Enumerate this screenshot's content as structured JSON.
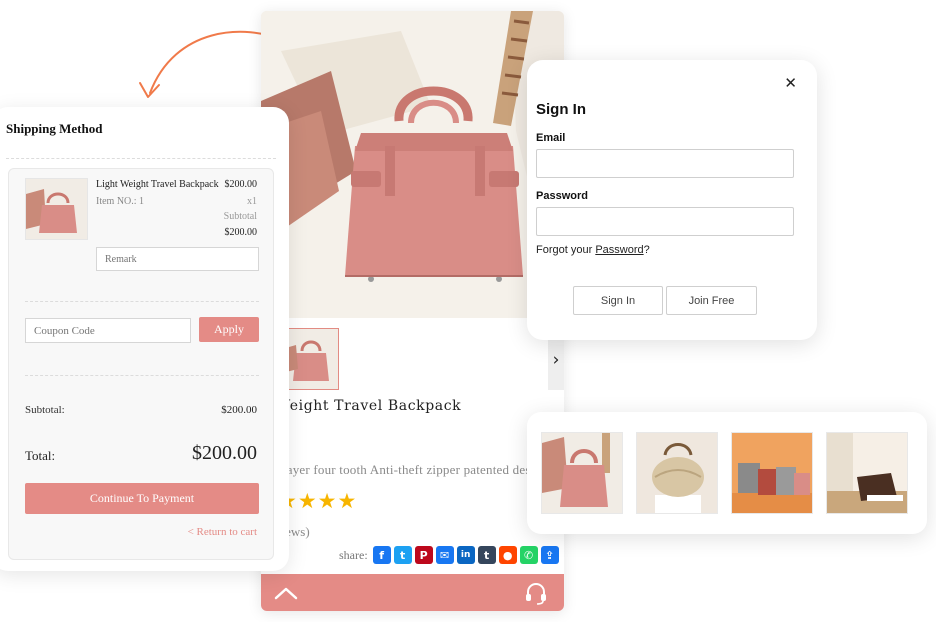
{
  "shipping": {
    "title": "Shipping Method",
    "item": {
      "name": "Light Weight Travel Backpack",
      "item_no": "Item NO.: 1",
      "price": "$200.00",
      "qty": "x1",
      "subtotal_label": "Subtotal",
      "subtotal_value": "$200.00"
    },
    "remark_placeholder": "Remark",
    "coupon_placeholder": "Coupon Code",
    "apply_label": "Apply",
    "subtotal_label": "Subtotal:",
    "subtotal_value": "$200.00",
    "total_label": "Total:",
    "total_value": "$200.00",
    "continue_label": "Continue To Payment",
    "return_label": "< Return to cart"
  },
  "product": {
    "title": "nt Weight Travel Backpack",
    "description": "ble layer four tooth Anti-theft zipper patented desig",
    "rating": 5,
    "reviews": "views)",
    "share_label": "share:",
    "share_icons": [
      {
        "name": "facebook",
        "glyph": "f",
        "color": "#1877f2"
      },
      {
        "name": "twitter",
        "glyph": "t",
        "color": "#1da1f2"
      },
      {
        "name": "pinterest",
        "glyph": "P",
        "color": "#bd081c"
      },
      {
        "name": "email",
        "glyph": "✉",
        "color": "#1877f2"
      },
      {
        "name": "linkedin",
        "glyph": "in",
        "color": "#0a66c2"
      },
      {
        "name": "tumblr",
        "glyph": "t",
        "color": "#35465c"
      },
      {
        "name": "reddit",
        "glyph": "●",
        "color": "#ff4500"
      },
      {
        "name": "whatsapp",
        "glyph": "✆",
        "color": "#25d366"
      },
      {
        "name": "share",
        "glyph": "⇪",
        "color": "#1877f2"
      }
    ]
  },
  "signin": {
    "title": "Sign In",
    "email_label": "Email",
    "password_label": "Password",
    "forgot_prefix": "Forgot your ",
    "forgot_link": "Password",
    "forgot_suffix": "?",
    "signin_button": "Sign In",
    "join_button": "Join Free"
  },
  "colors": {
    "accent": "#e48b86",
    "bag": "#d98d87",
    "star": "#f7b500",
    "arrow": "#f07a4a"
  },
  "icons": {
    "close": "close-icon",
    "next": "chevron-right-icon",
    "back_to_top": "chevron-up-icon",
    "support": "headset-icon"
  }
}
